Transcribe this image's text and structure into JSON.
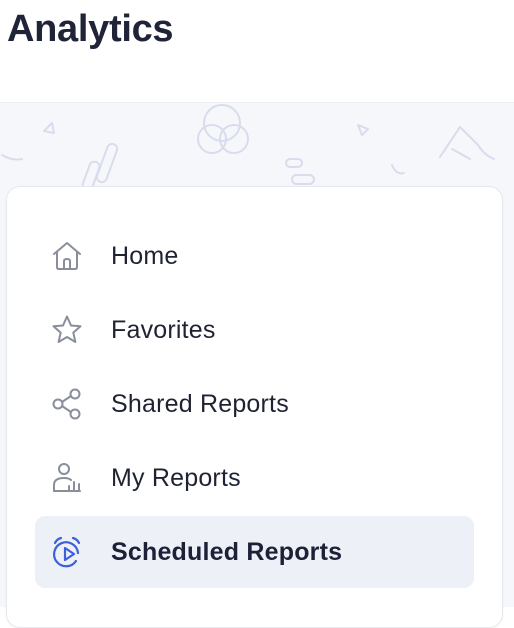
{
  "page": {
    "title": "Analytics"
  },
  "sidebar": {
    "items": [
      {
        "label": "Home",
        "icon": "home-icon",
        "active": false
      },
      {
        "label": "Favorites",
        "icon": "star-icon",
        "active": false
      },
      {
        "label": "Shared Reports",
        "icon": "share-icon",
        "active": false
      },
      {
        "label": "My Reports",
        "icon": "user-report-icon",
        "active": false
      },
      {
        "label": "Scheduled Reports",
        "icon": "alarm-clock-icon",
        "active": true
      }
    ]
  },
  "colors": {
    "accent": "#3d5fd9",
    "active_background": "#eef0f8",
    "icon_gray": "#8a8e9c",
    "text": "#1f2233"
  }
}
